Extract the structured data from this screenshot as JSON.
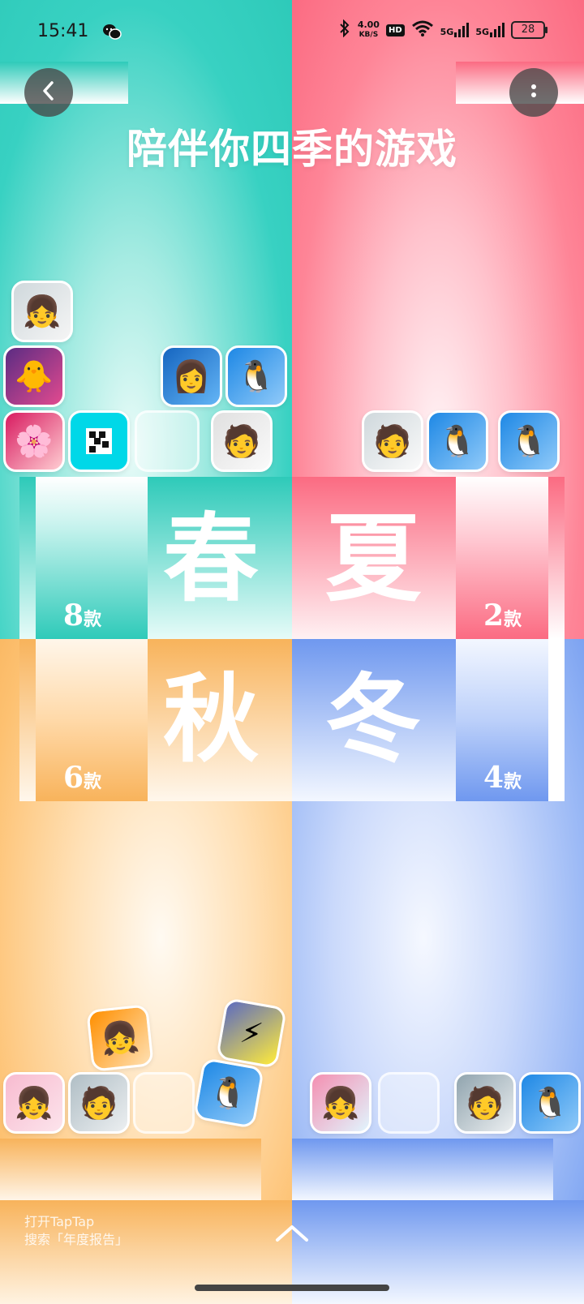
{
  "status_bar": {
    "time": "15:41",
    "net_speed_value": "4.00",
    "net_speed_unit": "KB/S",
    "hd_label": "HD",
    "signal_1_label": "5G",
    "signal_2_label": "5G",
    "battery": "28",
    "icons": [
      "wechat-icon",
      "bluetooth-icon",
      "wifi-icon",
      "signal-icon",
      "battery-icon"
    ]
  },
  "header": {
    "title": "陪伴你四季的游戏",
    "back_icon": "chevron-left-icon",
    "more_icon": "more-vertical-icon"
  },
  "seasons": [
    {
      "name": "春",
      "count_number": "8",
      "count_unit": "款",
      "color": "#2ecab9"
    },
    {
      "name": "夏",
      "count_number": "2",
      "count_unit": "款",
      "color": "#fb6b82"
    },
    {
      "name": "秋",
      "count_number": "6",
      "count_unit": "款",
      "color": "#f8b35b"
    },
    {
      "name": "冬",
      "count_number": "4",
      "count_unit": "款",
      "color": "#6f98ef"
    }
  ],
  "footer": {
    "hint_line1": "打开TapTap",
    "hint_line2": "搜索「年度报告」",
    "arrow_icon": "chevron-up-icon"
  }
}
